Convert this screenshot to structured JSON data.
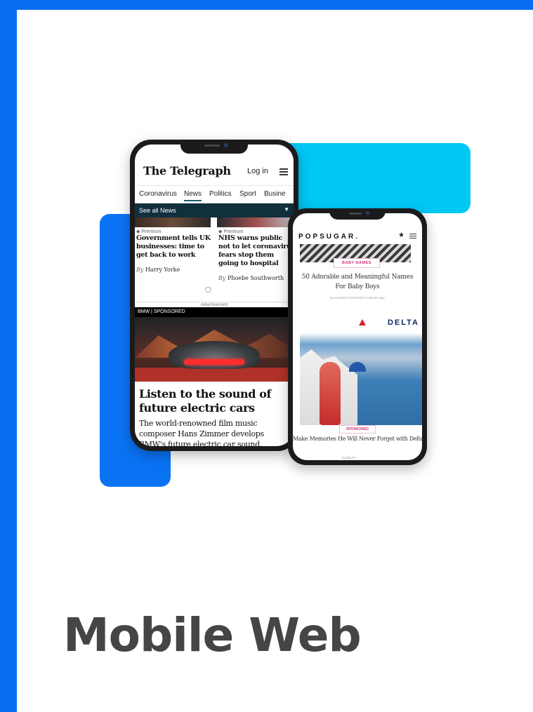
{
  "page": {
    "title": "Mobile Web"
  },
  "colors": {
    "frame_blue": "#0a6cf1",
    "accent_cyan": "#00c8f5",
    "title_gray": "#454545"
  },
  "telegraph": {
    "logo": "The Telegraph",
    "login": "Log in",
    "nav": [
      "Coronavirus",
      "News",
      "Politics",
      "Sport",
      "Busine"
    ],
    "active_nav": "News",
    "see_all": "See all News",
    "articles": [
      {
        "tag": "Premium",
        "title": "Government tells UK businesses: time to get back to work",
        "by": "By",
        "author": "Harry Yorke"
      },
      {
        "tag": "Premium",
        "title": "NHS warns public not to let coronavirus fears stop them going to hospital",
        "by": "By",
        "author": "Phoebe Southworth"
      }
    ],
    "advertisement": "Advertisement",
    "sponsored_label": "BMW | SPONSORED",
    "ad_headline": "Listen to the sound of future electric cars",
    "ad_description": "The world-renowned film music composer Hans Zimmer develops BMW's future electric car sound."
  },
  "popsugar": {
    "logo": "POPSUGAR.",
    "badge": "BABY NAMES",
    "article_title": "50 Adorable and Meaningful Names For Baby Boys",
    "meta": "by ALESSIA SANTORO  9 minutes ago",
    "ad_brand": "DELTA",
    "sponsored": "SPONSORED",
    "ad_caption": "Make Memories He Will Never Forget with Delta and American Express",
    "ad_by": "by DELTA"
  }
}
